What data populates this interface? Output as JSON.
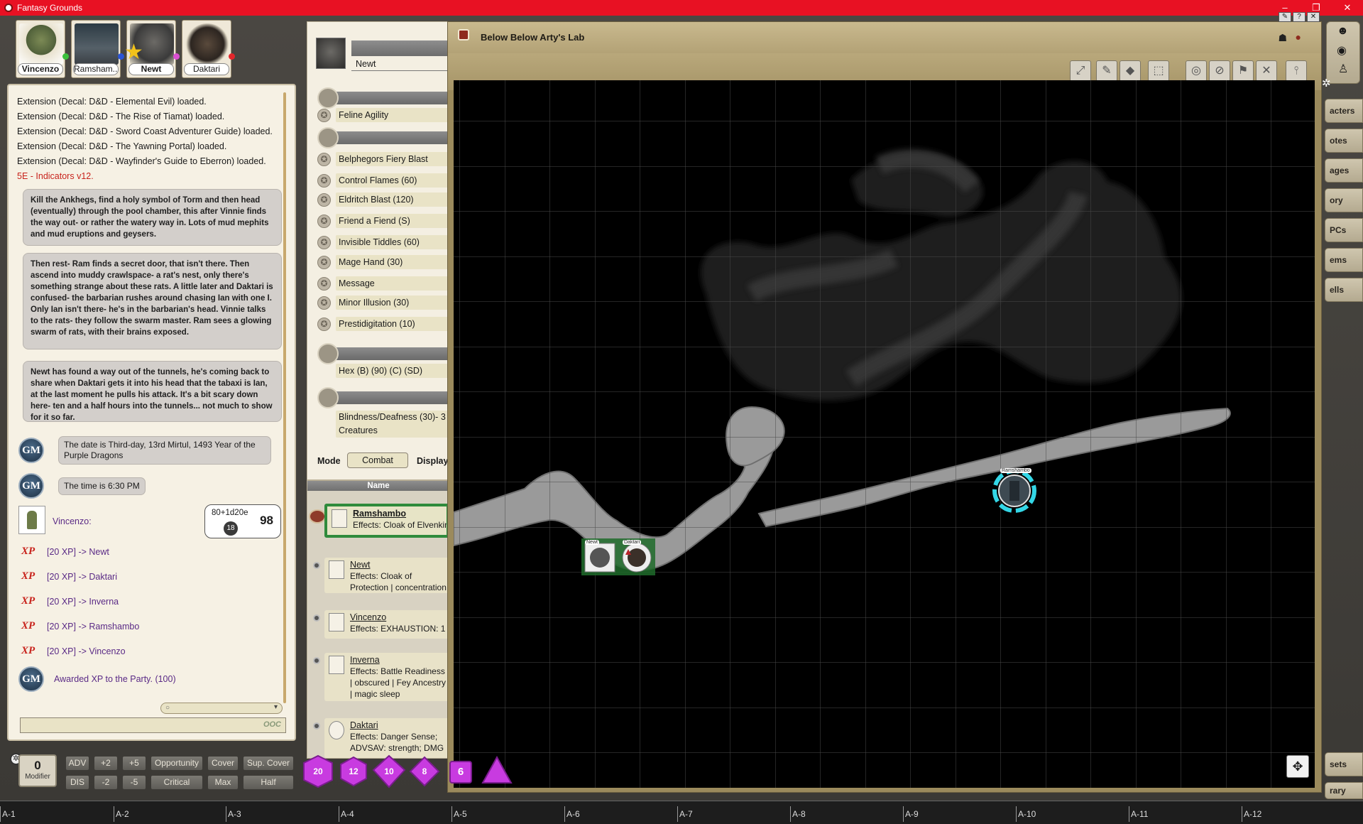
{
  "window": {
    "title": "Fantasy Grounds",
    "controls": [
      "–",
      "❐",
      "✕"
    ]
  },
  "party": [
    {
      "name": "Vincenzo",
      "status_color": "#3cc13c",
      "bold": true
    },
    {
      "name": "Ramsham...",
      "status_color": "#2b55d6",
      "bold": false
    },
    {
      "name": "Newt",
      "status_color": "#d94fd1",
      "bold": true
    },
    {
      "name": "Daktari",
      "status_color": "#e2262b",
      "bold": false
    }
  ],
  "chat": {
    "system_lines": [
      "Extension (Decal: D&D - Elemental Evil) loaded.",
      "Extension (Decal: D&D - The Rise of Tiamat) loaded.",
      "Extension (Decal: D&D - Sword Coast Adventurer Guide) loaded.",
      "Extension (Decal: D&D - The Yawning Portal) loaded.",
      "Extension (Decal: D&D - Wayfinder's Guide to Eberron) loaded."
    ],
    "indicator_line": "5E - Indicators v12.",
    "story": [
      "Kill the Ankhegs, find a holy symbol of Torm and then head (eventually) through the pool chamber, this after Vinnie finds the way out- or rather the watery way in. Lots of mud mephits and mud eruptions and geysers.",
      "Then rest- Ram finds a secret door, that isn't there. Then ascend into muddy crawlspace- a rat's nest, only there's something strange about these rats. A little later and Daktari is confused- the barbarian rushes around chasing Ian with one I. Only Ian isn't there- he's in the barbarian's head. Vinnie talks to the rats- they follow the swarm master. Ram sees a glowing swarm of rats, with their brains exposed.",
      "Newt has found a way out of the tunnels, he's coming back to share when Daktari gets it into his head that the tabaxi is Ian, at the last moment he pulls his attack. It's a bit scary down here- ten and a half hours into the tunnels... not much to show for it so far."
    ],
    "gm_label": "GM",
    "date_msg": "The date is Third-day, 13rd Mirtul, 1493 Year of the Purple Dragons",
    "time_msg": "The time is 6:30 PM",
    "roll": {
      "speaker": "Vincenzo:",
      "formula": "80+1d20e",
      "die": "18",
      "total": "98"
    },
    "xp_label": "XP",
    "xp_lines": [
      "[20 XP] -> Newt",
      "[20 XP] -> Daktari",
      "[20 XP] -> Inverna",
      "[20 XP] -> Ramshambo",
      "[20 XP] -> Vincenzo"
    ],
    "award_msg": "Awarded XP to the Party. (100)",
    "ooc_label": "OOC"
  },
  "charsheet": {
    "name": "Newt",
    "spells_group1": [
      "Feline Agility"
    ],
    "spells_group2": [
      "Belphegors Fiery Blast",
      "Control Flames (60)",
      "Eldritch Blast (120)",
      "Friend a Fiend (S)",
      "Invisible Tiddles (60)",
      "Mage Hand (30)",
      "Message",
      "Minor Illusion (30)",
      "Prestidigitation (10)"
    ],
    "spells_group3": [
      "Hex (B) (90) (C) (SD)"
    ],
    "spells_group4": [
      "Blindness/Deafness (30)- 3 Creatures"
    ],
    "mode_label": "Mode",
    "mode_value": "Combat",
    "display_label": "Display"
  },
  "tracker": {
    "header": "Name",
    "entries": [
      {
        "name": "Ramshambo",
        "effects": "Effects: Cloak of Elvenkind",
        "active": true
      },
      {
        "name": "Newt",
        "effects": "Effects: Cloak of Protection | concentration | Hex (C)",
        "active": false
      },
      {
        "name": "Vincenzo",
        "effects": "Effects: EXHAUSTION: 1",
        "active": false
      },
      {
        "name": "Inverna",
        "effects": "Effects: Battle Readiness | obscured | Fey Ancestry | magic sleep",
        "active": false
      },
      {
        "name": "Daktari",
        "effects": "Effects: Danger Sense; ADVSAV: strength; DMG",
        "active": false
      }
    ]
  },
  "map": {
    "title": "Below Below Arty's Lab",
    "tokens": [
      {
        "name": "Newt",
        "label": "Newt"
      },
      {
        "name": "Daktari",
        "label": "Daktari"
      },
      {
        "name": "Ramshambo",
        "label": "Ramshambo"
      }
    ]
  },
  "sidebar_tabs": [
    "acters",
    "otes",
    "ages",
    "ory",
    "PCs",
    "ems",
    "ells",
    "sets",
    "rary"
  ],
  "modifier": {
    "value": "0",
    "label": "Modifier"
  },
  "mod_buttons": {
    "row1": [
      "ADV",
      "+2",
      "+5",
      "Opportunity",
      "Cover",
      "Sup. Cover"
    ],
    "row2": [
      "DIS",
      "-2",
      "-5",
      "Critical",
      "Max",
      "Half"
    ]
  },
  "dice": [
    "20",
    "12",
    "10",
    "8",
    "6",
    "4"
  ],
  "dice_color": "#c83be0",
  "hotkeys": [
    "A-1",
    "A-2",
    "A-3",
    "A-4",
    "A-5",
    "A-6",
    "A-7",
    "A-8",
    "A-9",
    "A-10",
    "A-11",
    "A-12"
  ]
}
